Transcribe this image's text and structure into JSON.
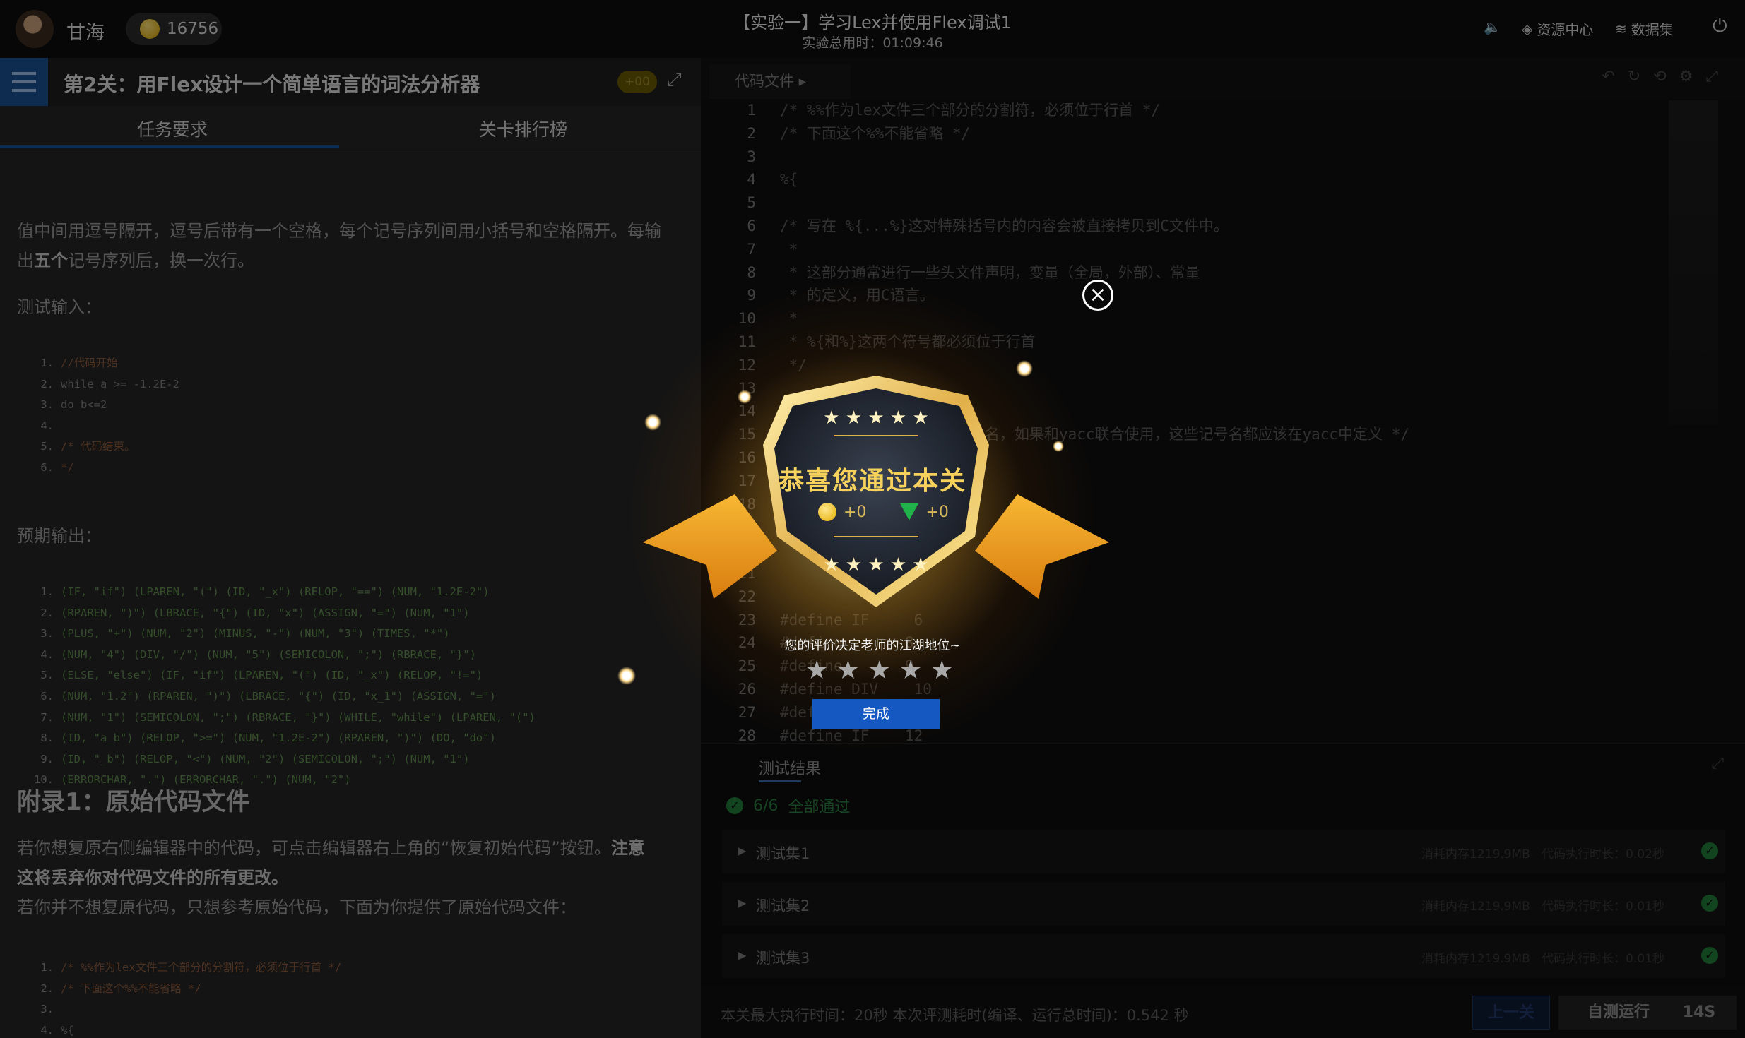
{
  "header": {
    "username": "甘海",
    "coins": "16756",
    "title": "【实验一】学习Lex并使用Flex调试1",
    "elapsed": "实验总用时：01:09:46",
    "resource_center": "资源中心",
    "dataset": "数据集"
  },
  "level": {
    "title": "第2关：用Flex设计一个简单语言的词法分析器",
    "badge": "+00",
    "tabs": [
      "任务要求",
      "关卡排行榜"
    ]
  },
  "content": {
    "para1_line1": "值中间用逗号隔开，逗号后带有一个空格，每个记号序列间用小括号和空格隔开。每输",
    "para1_line2_a": "出",
    "para1_line2_bold": "五个",
    "para1_line2_b": "记号序列后，换一次行。",
    "test_input_label": "测试输入：",
    "test_input": [
      "//代码开始",
      "while a >= -1.2E-2",
      "do b<=2",
      "",
      "/* 代码结束。",
      "*/"
    ],
    "expected_label": "预期输出：",
    "expected": [
      "(IF, \"if\") (LPAREN, \"(\") (ID, \"_x\") (RELOP, \"==\") (NUM, \"1.2E-2\")",
      "(RPAREN, \")\") (LBRACE, \"{\") (ID, \"x\") (ASSIGN, \"=\") (NUM, \"1\")",
      "(PLUS, \"+\") (NUM, \"2\") (MINUS, \"-\") (NUM, \"3\") (TIMES, \"*\")",
      "(NUM, \"4\") (DIV, \"/\") (NUM, \"5\") (SEMICOLON, \";\") (RBRACE, \"}\")",
      "(ELSE, \"else\") (IF, \"if\") (LPAREN, \"(\") (ID, \"_x\") (RELOP, \"!=\")",
      "(NUM, \"1.2\") (RPAREN, \")\") (LBRACE, \"{\") (ID, \"x_1\") (ASSIGN, \"=\")",
      "(NUM, \"1\") (SEMICOLON, \";\") (RBRACE, \"}\") (WHILE, \"while\") (LPAREN, \"(\")",
      "(ID, \"a_b\") (RELOP, \">=\") (NUM, \"1.2E-2\") (RPAREN, \")\") (DO, \"do\")",
      "(ID, \"_b\") (RELOP, \"<\") (NUM, \"2\") (SEMICOLON, \";\") (NUM, \"1\")",
      "(ERRORCHAR, \".\") (ERRORCHAR, \".\") (NUM, \"2\")"
    ],
    "appendix_title": "附录1：原始代码文件",
    "appendix_p1_a": "若你想复原右侧编辑器中的代码，可点击编辑器右上角的“恢复初始代码”按钮。",
    "appendix_p1_bold1": "注意",
    "appendix_p1_bold2": "这将丢弃你对代码文件的所有更改。",
    "appendix_p2": "若你并不想复原代码，只想参考原始代码，下面为你提供了原始代码文件：",
    "orig_code": [
      "/* %%作为lex文件三个部分的分割符，必须位于行首 */",
      "/* 下面这个%%不能省略 */",
      "",
      "%{"
    ]
  },
  "editor": {
    "tab": "代码文件",
    "line_numbers": [
      "1",
      "2",
      "3",
      "4",
      "5",
      "6",
      "7",
      "8",
      "9",
      "10",
      "11",
      "12",
      "13",
      "14",
      "15",
      "16",
      "17",
      "18",
      "19",
      "20",
      "21",
      "22",
      "23",
      "24",
      "25",
      "26",
      "27",
      "28"
    ],
    "lines": [
      "/* %%作为lex文件三个部分的分割符，必须位于行首 */",
      "/* 下面这个%%不能省略 */",
      "",
      "%{",
      "",
      "/* 写在 %{...%}这对特殊括号内的内容会被直接拷贝到C文件中。",
      " *",
      " * 这部分通常进行一些头文件声明，变量（全局，外部）、常量",
      " * 的定义，用C语言。",
      " *",
      " * %{和%}这两个符号都必须位于行首",
      " */",
      "",
      "",
      "/* 下面定义了需要识别的记号名，如果和yacc联合使用，这些记号名都应该在yacc中定义 */",
      "",
      "",
      "",
      "",
      "",
      "",
      "",
      "#define IF     6",
      "#define       8",
      "#define       9",
      "#define DIV    10",
      "#define       11",
      "#define IF    12"
    ]
  },
  "results": {
    "title": "测试结果",
    "summary_count": "6/6",
    "summary_text": "全部通过",
    "sets": [
      {
        "name": "测试集1",
        "mem": "消耗内存1219.9MB",
        "time": "代码执行时长：0.02秒"
      },
      {
        "name": "测试集2",
        "mem": "消耗内存1219.9MB",
        "time": "代码执行时长：0.01秒"
      },
      {
        "name": "测试集3",
        "mem": "消耗内存1219.9MB",
        "time": "代码执行时长：0.01秒"
      }
    ],
    "footer": "本关最大执行时间：20秒    本次评测耗时(编译、运行总时间)：0.542 秒",
    "prev_btn": "上一关",
    "selftest_btn": "自测运行",
    "timer_btn": "14S"
  },
  "modal": {
    "congrats": "恭喜您通过本关",
    "coin_reward": "+0",
    "gem_reward": "+0",
    "rate_prompt": "您的评价决定老师的江湖地位~",
    "done_btn": "完成",
    "close_glyph": "×"
  },
  "colors": {
    "accent_blue": "#1658c2",
    "gold": "#f6d25d",
    "pass_green": "#1f7d39"
  }
}
